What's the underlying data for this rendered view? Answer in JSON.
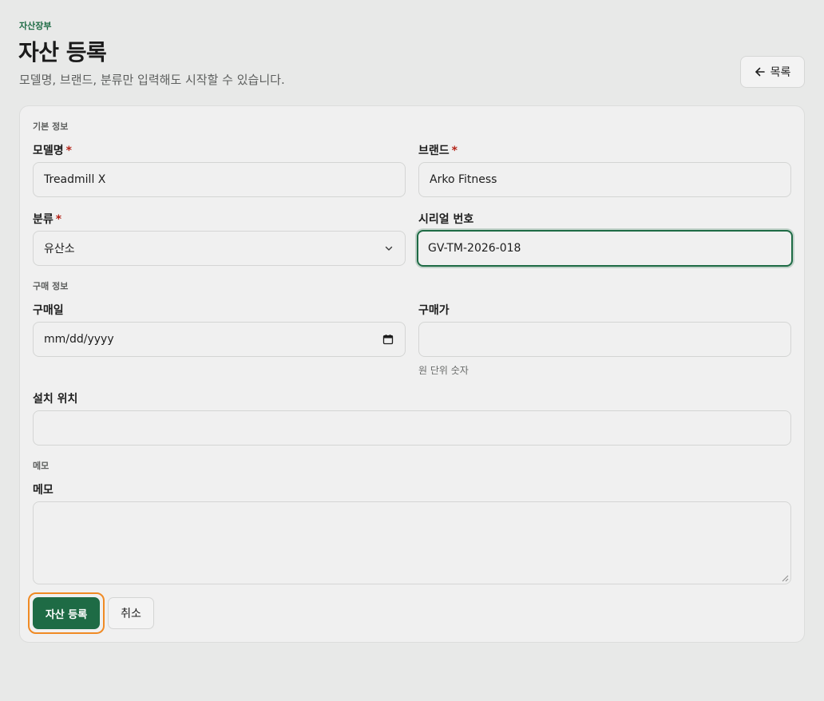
{
  "header": {
    "eyebrow": "자산장부",
    "title": "자산 등록",
    "subtitle": "모델명, 브랜드, 분류만 입력해도 시작할 수 있습니다.",
    "back_label": "목록"
  },
  "sections": {
    "basic": "기본 정보",
    "purchase": "구매 정보",
    "memo": "메모"
  },
  "fields": {
    "model": {
      "label": "모델명",
      "required_mark": "*",
      "value": "Treadmill X"
    },
    "brand": {
      "label": "브랜드",
      "required_mark": "*",
      "value": "Arko Fitness"
    },
    "category": {
      "label": "분류",
      "required_mark": "*",
      "value": "유산소"
    },
    "serial": {
      "label": "시리얼 번호",
      "value": "GV-TM-2026-018"
    },
    "purchase_date": {
      "label": "구매일",
      "value": "mm/dd/yyyy"
    },
    "purchase_price": {
      "label": "구매가",
      "value": "",
      "hint": "원 단위 숫자"
    },
    "location": {
      "label": "설치 위치",
      "value": ""
    },
    "memo": {
      "label": "메모",
      "value": ""
    }
  },
  "actions": {
    "submit": "자산 등록",
    "cancel": "취소"
  },
  "colors": {
    "accent": "#1e6b45",
    "focus_ring": "#f08a24",
    "required": "#b42318"
  }
}
